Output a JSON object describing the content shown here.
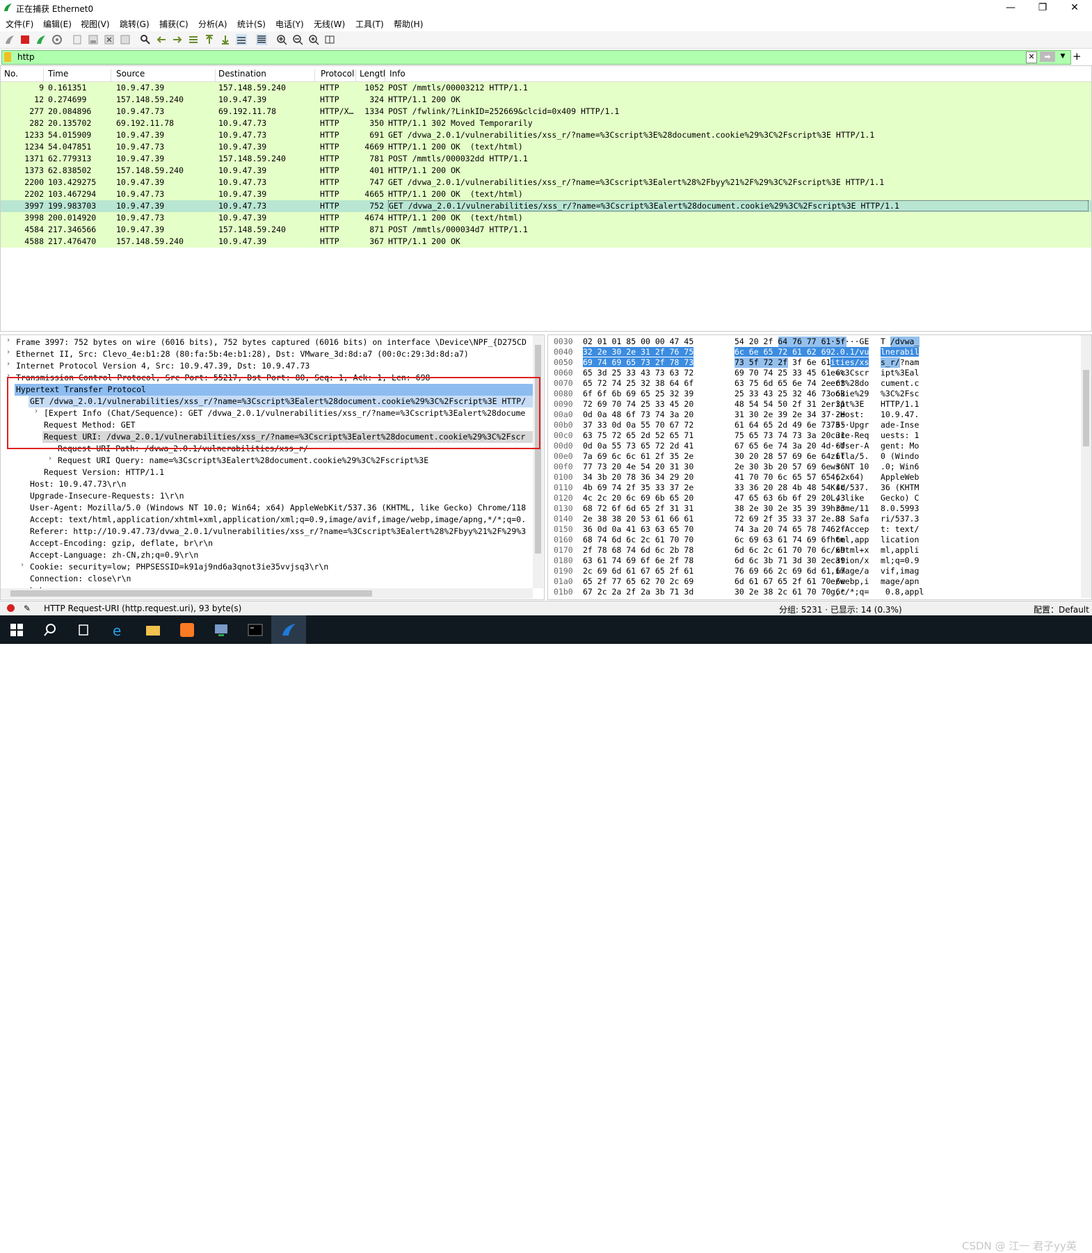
{
  "title": "正在捕获 Ethernet0",
  "menu": [
    "文件(F)",
    "编辑(E)",
    "视图(V)",
    "跳转(G)",
    "捕获(C)",
    "分析(A)",
    "统计(S)",
    "电话(Y)",
    "无线(W)",
    "工具(T)",
    "帮助(H)"
  ],
  "filter": {
    "value": "http"
  },
  "columns": [
    "No.",
    "Time",
    "Source",
    "Destination",
    "Protocol",
    "Lengtl",
    "Info"
  ],
  "packets": [
    {
      "no": "9",
      "time": "0.161351",
      "src": "10.9.47.39",
      "dst": "157.148.59.240",
      "proto": "HTTP",
      "len": "1052",
      "info": "POST /mmtls/00003212 HTTP/1.1"
    },
    {
      "no": "12",
      "time": "0.274699",
      "src": "157.148.59.240",
      "dst": "10.9.47.39",
      "proto": "HTTP",
      "len": "324",
      "info": "HTTP/1.1 200 OK"
    },
    {
      "no": "277",
      "time": "20.084896",
      "src": "10.9.47.73",
      "dst": "69.192.11.78",
      "proto": "HTTP/X…",
      "len": "1334",
      "info": "POST /fwlink/?LinkID=252669&clcid=0x409 HTTP/1.1"
    },
    {
      "no": "282",
      "time": "20.135702",
      "src": "69.192.11.78",
      "dst": "10.9.47.73",
      "proto": "HTTP",
      "len": "350",
      "info": "HTTP/1.1 302 Moved Temporarily"
    },
    {
      "no": "1233",
      "time": "54.015909",
      "src": "10.9.47.39",
      "dst": "10.9.47.73",
      "proto": "HTTP",
      "len": "691",
      "info": "GET /dvwa_2.0.1/vulnerabilities/xss_r/?name=%3Cscript%3E%28document.cookie%29%3C%2Fscript%3E HTTP/1.1"
    },
    {
      "no": "1234",
      "time": "54.047851",
      "src": "10.9.47.73",
      "dst": "10.9.47.39",
      "proto": "HTTP",
      "len": "4669",
      "info": "HTTP/1.1 200 OK  (text/html)"
    },
    {
      "no": "1371",
      "time": "62.779313",
      "src": "10.9.47.39",
      "dst": "157.148.59.240",
      "proto": "HTTP",
      "len": "781",
      "info": "POST /mmtls/000032dd HTTP/1.1"
    },
    {
      "no": "1373",
      "time": "62.838502",
      "src": "157.148.59.240",
      "dst": "10.9.47.39",
      "proto": "HTTP",
      "len": "401",
      "info": "HTTP/1.1 200 OK"
    },
    {
      "no": "2200",
      "time": "103.429275",
      "src": "10.9.47.39",
      "dst": "10.9.47.73",
      "proto": "HTTP",
      "len": "747",
      "info": "GET /dvwa_2.0.1/vulnerabilities/xss_r/?name=%3Cscript%3Ealert%28%2Fbyy%21%2F%29%3C%2Fscript%3E HTTP/1.1"
    },
    {
      "no": "2202",
      "time": "103.467294",
      "src": "10.9.47.73",
      "dst": "10.9.47.39",
      "proto": "HTTP",
      "len": "4665",
      "info": "HTTP/1.1 200 OK  (text/html)"
    },
    {
      "no": "3997",
      "time": "199.983703",
      "src": "10.9.47.39",
      "dst": "10.9.47.73",
      "proto": "HTTP",
      "len": "752",
      "info": "GET /dvwa_2.0.1/vulnerabilities/xss_r/?name=%3Cscript%3Ealert%28document.cookie%29%3C%2Fscript%3E HTTP/1.1",
      "selected": true
    },
    {
      "no": "3998",
      "time": "200.014920",
      "src": "10.9.47.73",
      "dst": "10.9.47.39",
      "proto": "HTTP",
      "len": "4674",
      "info": "HTTP/1.1 200 OK  (text/html)"
    },
    {
      "no": "4584",
      "time": "217.346566",
      "src": "10.9.47.39",
      "dst": "157.148.59.240",
      "proto": "HTTP",
      "len": "871",
      "info": "POST /mmtls/000034d7 HTTP/1.1"
    },
    {
      "no": "4588",
      "time": "217.476470",
      "src": "157.148.59.240",
      "dst": "10.9.47.39",
      "proto": "HTTP",
      "len": "367",
      "info": "HTTP/1.1 200 OK"
    }
  ],
  "details": [
    {
      "t": ">",
      "text": "Frame 3997: 752 bytes on wire (6016 bits), 752 bytes captured (6016 bits) on interface \\Device\\NPF_{D275CD",
      "lvl": 0
    },
    {
      "t": ">",
      "text": "Ethernet II, Src: Clevo_4e:b1:28 (80:fa:5b:4e:b1:28), Dst: VMware_3d:8d:a7 (00:0c:29:3d:8d:a7)",
      "lvl": 0
    },
    {
      "t": ">",
      "text": "Internet Protocol Version 4, Src: 10.9.47.39, Dst: 10.9.47.73",
      "lvl": 0
    },
    {
      "t": ">",
      "text": "Transmission Control Protocol, Src Port: 55217, Dst Port: 80, Seq: 1, Ack: 1, Len: 698",
      "lvl": 0
    },
    {
      "t": "v",
      "text": "Hypertext Transfer Protocol",
      "lvl": 0,
      "hl": "strong"
    },
    {
      "t": "v",
      "text": "GET /dvwa_2.0.1/vulnerabilities/xss_r/?name=%3Cscript%3Ealert%28document.cookie%29%3C%2Fscript%3E HTTP/",
      "lvl": 1,
      "hl": "light"
    },
    {
      "t": ">",
      "text": "[Expert Info (Chat/Sequence): GET /dvwa_2.0.1/vulnerabilities/xss_r/?name=%3Cscript%3Ealert%28docume",
      "lvl": 2
    },
    {
      "t": "",
      "text": "Request Method: GET",
      "lvl": 2
    },
    {
      "t": "v",
      "text": "Request URI: /dvwa_2.0.1/vulnerabilities/xss_r/?name=%3Cscript%3Ealert%28document.cookie%29%3C%2Fscr",
      "lvl": 2,
      "hl": "grey"
    },
    {
      "t": "",
      "text": "Request URI Path: /dvwa_2.0.1/vulnerabilities/xss_r/",
      "lvl": 3
    },
    {
      "t": ">",
      "text": "Request URI Query: name=%3Cscript%3Ealert%28document.cookie%29%3C%2Fscript%3E",
      "lvl": 3
    },
    {
      "t": "",
      "text": "Request Version: HTTP/1.1",
      "lvl": 2
    },
    {
      "t": "",
      "text": "Host: 10.9.47.73\\r\\n",
      "lvl": 1
    },
    {
      "t": "",
      "text": "Upgrade-Insecure-Requests: 1\\r\\n",
      "lvl": 1
    },
    {
      "t": "",
      "text": "User-Agent: Mozilla/5.0 (Windows NT 10.0; Win64; x64) AppleWebKit/537.36 (KHTML, like Gecko) Chrome/118",
      "lvl": 1
    },
    {
      "t": "",
      "text": "Accept: text/html,application/xhtml+xml,application/xml;q=0.9,image/avif,image/webp,image/apng,*/*;q=0.",
      "lvl": 1
    },
    {
      "t": "",
      "text": "Referer: http://10.9.47.73/dvwa_2.0.1/vulnerabilities/xss_r/?name=%3Cscript%3Ealert%28%2Fbyy%21%2F%29%3",
      "lvl": 1
    },
    {
      "t": "",
      "text": "Accept-Encoding: gzip, deflate, br\\r\\n",
      "lvl": 1
    },
    {
      "t": "",
      "text": "Accept-Language: zh-CN,zh;q=0.9\\r\\n",
      "lvl": 1
    },
    {
      "t": ">",
      "text": "Cookie: security=low; PHPSESSID=k91aj9nd6a3qnot3ie35vvjsq3\\r\\n",
      "lvl": 1
    },
    {
      "t": "",
      "text": "Connection: close\\r\\n",
      "lvl": 1
    },
    {
      "t": "",
      "text": "\\r\\n",
      "lvl": 1
    }
  ],
  "hex": [
    {
      "off": "0030",
      "b1": "02 01 01 85 00 00 47 45",
      "b2": "54 20 2f 64 76 77 61 5f",
      "a1": "······GE",
      "a2": "T /dvwa_",
      "h1": "",
      "h2": "5-"
    },
    {
      "off": "0040",
      "b1": "32 2e 30 2e 31 2f 76 75",
      "b2": "6c 6e 65 72 61 62 69 6c",
      "a1": "2.0.1/vu",
      "a2": "lnerabil",
      "h1": "all",
      "h2": "all"
    },
    {
      "off": "0050",
      "b1": "69 74 69 65 73 2f 78 73",
      "b2": "73 5f 72 2f 3f 6e 61 6d",
      "a1": "ities/xs",
      "a2": "s_r/?nam",
      "h1": "all",
      "h2": "-4"
    },
    {
      "off": "0060",
      "b1": "65 3d 25 33 43 73 63 72",
      "b2": "69 70 74 25 33 45 61 6c",
      "a1": "e=%3Cscr",
      "a2": "ipt%3Eal"
    },
    {
      "off": "0070",
      "b1": "65 72 74 25 32 38 64 6f",
      "b2": "63 75 6d 65 6e 74 2e 63",
      "a1": "ert%28do",
      "a2": "cument.c"
    },
    {
      "off": "0080",
      "b1": "6f 6f 6b 69 65 25 32 39",
      "b2": "25 33 43 25 32 46 73 63",
      "a1": "ookie%29",
      "a2": "%3C%2Fsc"
    },
    {
      "off": "0090",
      "b1": "72 69 70 74 25 33 45 20",
      "b2": "48 54 54 50 2f 31 2e 31",
      "a1": "ript%3E ",
      "a2": "HTTP/1.1"
    },
    {
      "off": "00a0",
      "b1": "0d 0a 48 6f 73 74 3a 20",
      "b2": "31 30 2e 39 2e 34 37 2e",
      "a1": "··Host: ",
      "a2": "10.9.47."
    },
    {
      "off": "00b0",
      "b1": "37 33 0d 0a 55 70 67 72",
      "b2": "61 64 65 2d 49 6e 73 65",
      "a1": "73··Upgr",
      "a2": "ade-Inse"
    },
    {
      "off": "00c0",
      "b1": "63 75 72 65 2d 52 65 71",
      "b2": "75 65 73 74 73 3a 20 31",
      "a1": "cure-Req",
      "a2": "uests: 1"
    },
    {
      "off": "00d0",
      "b1": "0d 0a 55 73 65 72 2d 41",
      "b2": "67 65 6e 74 3a 20 4d 6f",
      "a1": "··User-A",
      "a2": "gent: Mo"
    },
    {
      "off": "00e0",
      "b1": "7a 69 6c 6c 61 2f 35 2e",
      "b2": "30 20 28 57 69 6e 64 6f",
      "a1": "zilla/5.",
      "a2": "0 (Windo"
    },
    {
      "off": "00f0",
      "b1": "77 73 20 4e 54 20 31 30",
      "b2": "2e 30 3b 20 57 69 6e 36",
      "a1": "ws NT 10",
      ".a2": "",
      "a2": ".0; Win6"
    },
    {
      "off": "0100",
      "b1": "34 3b 20 78 36 34 29 20",
      "b2": "41 70 70 6c 65 57 65 62",
      "a1": "4; x64) ",
      "a2": "AppleWeb"
    },
    {
      "off": "0110",
      "b1": "4b 69 74 2f 35 33 37 2e",
      "b2": "33 36 20 28 4b 48 54 4d",
      "a1": "Kit/537.",
      "a2": "36 (KHTM"
    },
    {
      "off": "0120",
      "b1": "4c 2c 20 6c 69 6b 65 20",
      "b2": "47 65 63 6b 6f 29 20 43",
      "a1": "L, like ",
      "a2": "Gecko) C"
    },
    {
      "off": "0130",
      "b1": "68 72 6f 6d 65 2f 31 31",
      "b2": "38 2e 30 2e 35 39 39 33",
      "a1": "hrome/11",
      "a2": "8.0.5993"
    },
    {
      "off": "0140",
      "b1": "2e 38 38 20 53 61 66 61",
      "b2": "72 69 2f 35 33 37 2e 33",
      "a1": ".88 Safa",
      "a2": "ri/537.3"
    },
    {
      "off": "0150",
      "b1": "36 0d 0a 41 63 63 65 70",
      "b2": "74 3a 20 74 65 78 74 2f",
      "a1": "6··Accep",
      "a2": "t: text/"
    },
    {
      "off": "0160",
      "b1": "68 74 6d 6c 2c 61 70 70",
      "b2": "6c 69 63 61 74 69 6f 6e",
      "a1": "html,app",
      "a2": "lication"
    },
    {
      "off": "0170",
      "b1": "2f 78 68 74 6d 6c 2b 78",
      "b2": "6d 6c 2c 61 70 70 6c 69",
      "a1": "/xhtml+x",
      "a2": "ml,appli"
    },
    {
      "off": "0180",
      "b1": "63 61 74 69 6f 6e 2f 78",
      "b2": "6d 6c 3b 71 3d 30 2e 39",
      "a1": "cation/x",
      "a2": "ml;q=0.9"
    },
    {
      "off": "0190",
      "b1": "2c 69 6d 61 67 65 2f 61",
      "b2": "76 69 66 2c 69 6d 61 67",
      "a1": ",image/a",
      "a2": "vif,imag"
    },
    {
      "off": "01a0",
      "b1": "65 2f 77 65 62 70 2c 69",
      "b2": "6d 61 67 65 2f 61 70 6e",
      "a1": "e/webp,i",
      "a2": "mage/apn"
    },
    {
      "off": "01b0",
      "b1": "67 2c 2a 2f 2a 3b 71 3d",
      "b2": "30 2e 38 2c 61 70 70 6c",
      "a1": "g,*/*;q=",
      "a2": " 0.8,appl"
    }
  ],
  "status": {
    "field": "HTTP Request-URI (http.request.uri), 93 byte(s)",
    "counts": "分组: 5231 · 已显示: 14 (0.3%)",
    "profile": "配置：Default"
  },
  "watermark": "CSDN @ 江一 君子yy英",
  "colors": {
    "row_bg": "#e4ffc7",
    "row_selected": "#b9e6d3",
    "filter_bg": "#afffaf",
    "highlight": "#3c8ce0",
    "redbox": "#e02020"
  }
}
